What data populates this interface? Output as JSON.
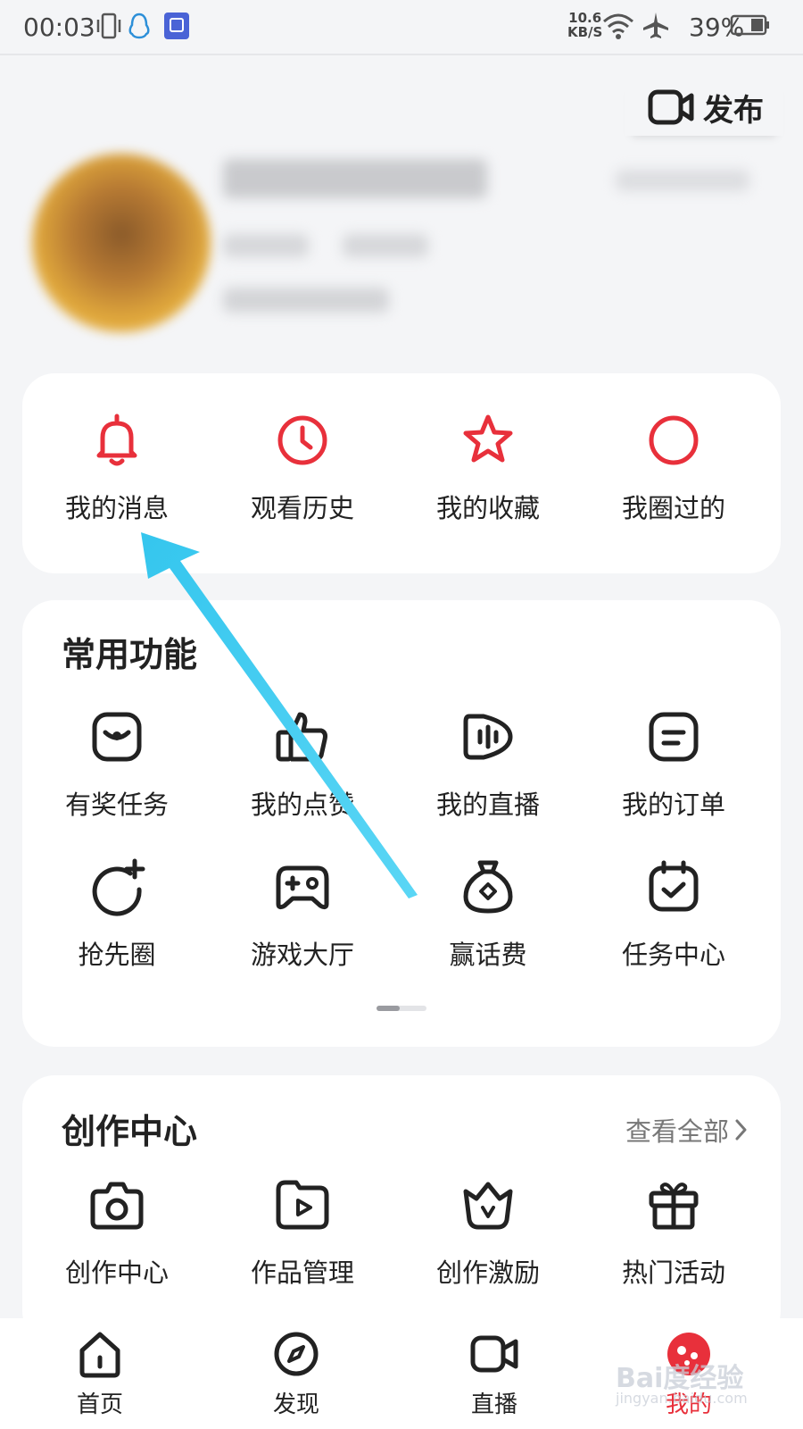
{
  "status_bar": {
    "time": "00:03",
    "net_speed_value": "10.6",
    "net_speed_unit": "KB/S",
    "battery": "39%",
    "icons": [
      "vibrate-icon",
      "qq-icon",
      "app-notification-icon",
      "wifi-icon",
      "airplane-mode-icon",
      "battery-icon"
    ]
  },
  "header": {
    "publish_label": "发布",
    "publish_icon": "video-camera-icon"
  },
  "quick_actions": [
    {
      "label": "我的消息",
      "icon": "bell-icon"
    },
    {
      "label": "观看历史",
      "icon": "clock-icon"
    },
    {
      "label": "我的收藏",
      "icon": "star-icon"
    },
    {
      "label": "我圈过的",
      "icon": "circle-icon"
    }
  ],
  "accent_color": "#e8303b",
  "common_functions": {
    "title": "常用功能",
    "items": [
      {
        "label": "有奖任务",
        "icon": "reward-task-icon"
      },
      {
        "label": "我的点赞",
        "icon": "thumbs-up-icon"
      },
      {
        "label": "我的直播",
        "icon": "live-stream-icon"
      },
      {
        "label": "我的订单",
        "icon": "order-icon"
      },
      {
        "label": "抢先圈",
        "icon": "circle-plus-icon"
      },
      {
        "label": "游戏大厅",
        "icon": "gamepad-icon"
      },
      {
        "label": "赢话费",
        "icon": "money-bag-icon"
      },
      {
        "label": "任务中心",
        "icon": "calendar-check-icon"
      }
    ],
    "pager": {
      "pages": 2,
      "current": 1
    }
  },
  "creation_center": {
    "title": "创作中心",
    "view_all": "查看全部",
    "items": [
      {
        "label": "创作中心",
        "icon": "camera-icon"
      },
      {
        "label": "作品管理",
        "icon": "video-folder-icon"
      },
      {
        "label": "创作激励",
        "icon": "crown-icon"
      },
      {
        "label": "热门活动",
        "icon": "gift-icon"
      }
    ]
  },
  "tab_bar": [
    {
      "label": "首页",
      "icon": "home-icon",
      "active": false
    },
    {
      "label": "发现",
      "icon": "compass-icon",
      "active": false
    },
    {
      "label": "直播",
      "icon": "video-camera-icon",
      "active": false
    },
    {
      "label": "我的",
      "icon": "profile-icon",
      "active": true
    }
  ],
  "watermark": {
    "text": "Bai度经验",
    "sub": "jingyan.baidu.com"
  }
}
